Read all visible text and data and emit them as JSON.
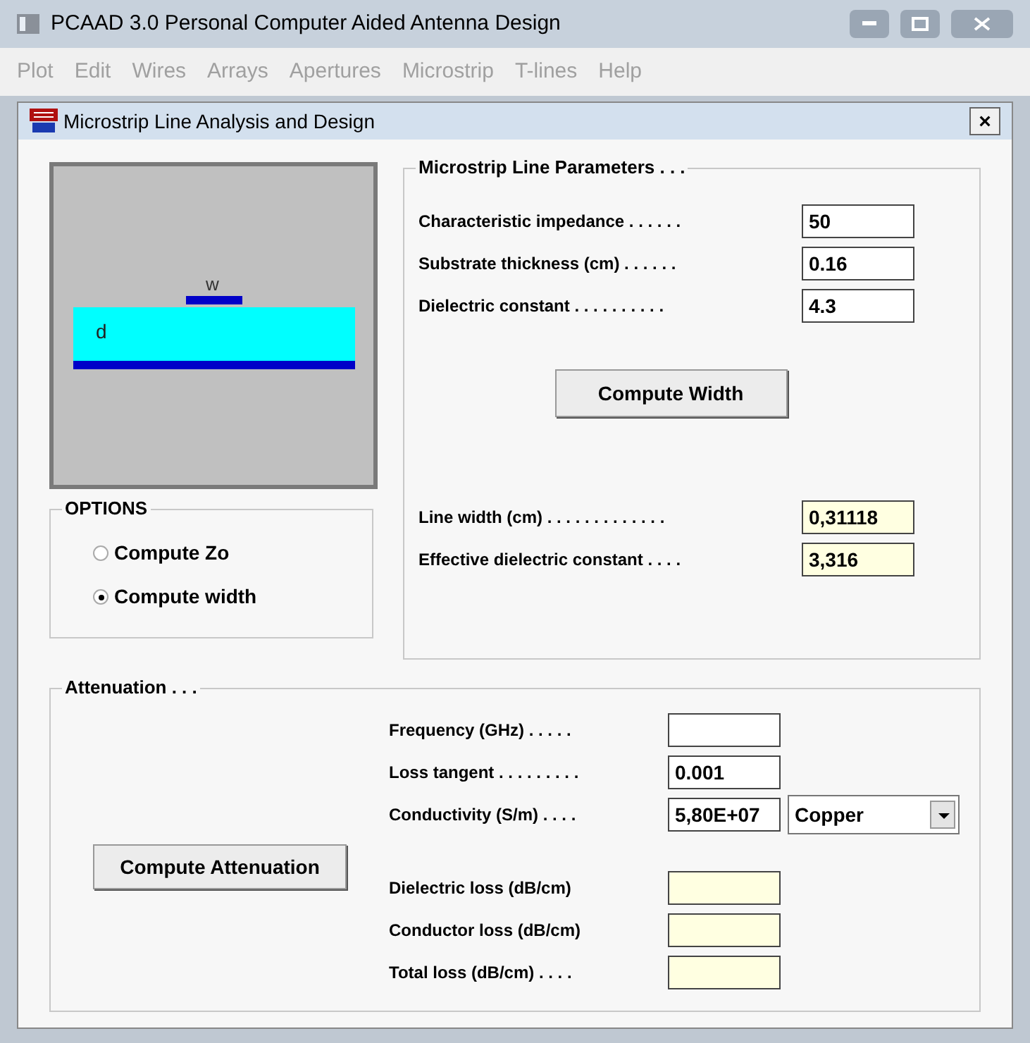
{
  "window": {
    "title": "PCAAD 3.0  Personal Computer Aided Antenna Design"
  },
  "menu": [
    {
      "label": "Plot",
      "disabled": true
    },
    {
      "label": "Edit",
      "disabled": true
    },
    {
      "label": "Wires",
      "disabled": true
    },
    {
      "label": "Arrays",
      "disabled": true
    },
    {
      "label": "Apertures",
      "disabled": true
    },
    {
      "label": "Microstrip",
      "disabled": true
    },
    {
      "label": "T-lines",
      "disabled": true
    },
    {
      "label": "Help",
      "disabled": true
    }
  ],
  "dialog": {
    "title": "Microstrip Line Analysis and Design",
    "close": "×"
  },
  "diagram": {
    "width_label": "w",
    "thickness_label": "d"
  },
  "options": {
    "title": "OPTIONS",
    "items": [
      {
        "label": "Compute Zo",
        "selected": false
      },
      {
        "label": "Compute width",
        "selected": true
      }
    ]
  },
  "parameters": {
    "title": "Microstrip Line Parameters . . .",
    "inputs": [
      {
        "label": "Characteristic impedance . . . . . .",
        "value": "50",
        "kind": "input"
      },
      {
        "label": "Substrate thickness (cm) . . . . . .",
        "value": "0.16",
        "kind": "input"
      },
      {
        "label": "Dielectric constant . . . . . . . . . .",
        "value": "4.3",
        "kind": "input"
      }
    ],
    "button": "Compute Width",
    "outputs": [
      {
        "label": "Line width (cm) . . . . . . . . . . . . .",
        "value": "0,31118",
        "kind": "output"
      },
      {
        "label": "Effective dielectric constant . . . .",
        "value": "3,316",
        "kind": "output"
      }
    ]
  },
  "attenuation": {
    "title": "Attenuation . . .",
    "button": "Compute Attenuation",
    "inputs": [
      {
        "label": "Frequency (GHz) . . . . .",
        "kind": "input"
      },
      {
        "label": "Loss tangent . . . . . . . . .",
        "value": "0.001",
        "kind": "input"
      },
      {
        "label": "Conductivity (S/m) . . . .",
        "value": "5,80E+07",
        "kind": "input"
      }
    ],
    "material": "Copper",
    "outputs": [
      {
        "label": "Dielectric loss (dB/cm)",
        "kind": "output"
      },
      {
        "label": "Conductor loss (dB/cm)",
        "kind": "output"
      },
      {
        "label": "Total loss (dB/cm) . . . .",
        "kind": "output"
      }
    ]
  }
}
